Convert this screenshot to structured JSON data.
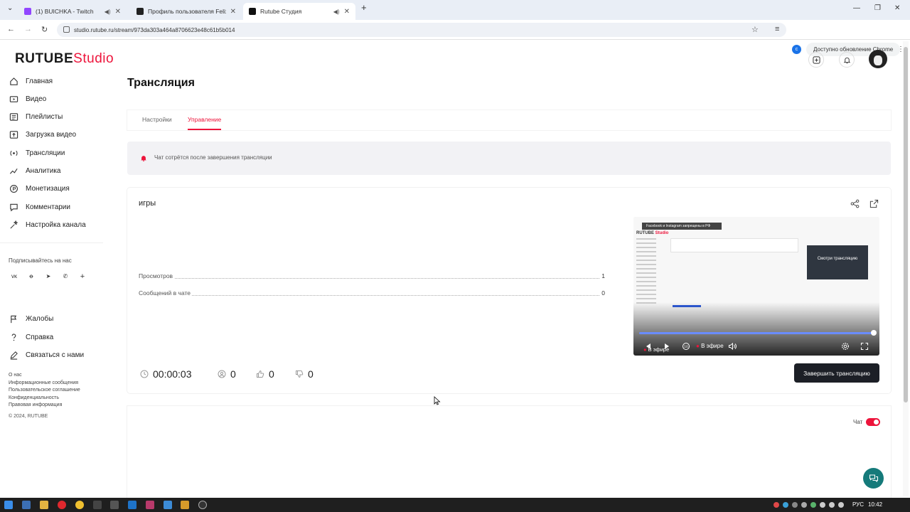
{
  "browser": {
    "tabs": [
      {
        "title": "(1) BUICHKA - Twitch",
        "favicon_color": "#9146ff"
      },
      {
        "title": "Профиль пользователя Felix",
        "favicon_color": "#222222"
      },
      {
        "title": "Rutube Студия",
        "favicon_color": "#111111"
      }
    ],
    "url": "studio.rutube.ru/stream/973da303a464a8706623e48c61b5b014",
    "profile_letter": "c",
    "update_label": "Доступно обновление Chrome"
  },
  "app": {
    "logo_main": "RUTUBE",
    "logo_studio": "Studio",
    "brand_color": "#ed143b"
  },
  "sidebar": {
    "items": [
      {
        "label": "Главная",
        "icon": "home-icon"
      },
      {
        "label": "Видео",
        "icon": "video-icon"
      },
      {
        "label": "Плейлисты",
        "icon": "playlist-icon"
      },
      {
        "label": "Загрузка видео",
        "icon": "upload-icon"
      },
      {
        "label": "Трансляции",
        "icon": "broadcast-icon"
      },
      {
        "label": "Аналитика",
        "icon": "analytics-icon"
      },
      {
        "label": "Монетизация",
        "icon": "monetization-icon"
      },
      {
        "label": "Комментарии",
        "icon": "comments-icon"
      },
      {
        "label": "Настройка канала",
        "icon": "channel-settings-icon"
      }
    ],
    "subscribe_label": "Подписывайтесь на нас",
    "socials": [
      "vk",
      "ok",
      "telegram",
      "viber",
      "more"
    ],
    "secondary": [
      {
        "label": "Жалобы",
        "icon": "flag-icon"
      },
      {
        "label": "Справка",
        "icon": "help-icon"
      },
      {
        "label": "Связаться с нами",
        "icon": "pencil-icon"
      }
    ],
    "footer_links": [
      "О нас",
      "Информационные сообщения",
      "Пользовательское соглашение",
      "Конфиденциальность",
      "Правовая информация"
    ],
    "copyright": "© 2024, RUTUBE"
  },
  "page": {
    "title": "Трансляция",
    "tabs": [
      "Настройки",
      "Управление"
    ],
    "active_tab": "Управление",
    "notice": "Чат сотрётся после завершения трансляции"
  },
  "stream": {
    "name": "игры",
    "stats": [
      {
        "label": "Просмотров",
        "value": "1"
      },
      {
        "label": "Сообщений в чате",
        "value": "0"
      }
    ],
    "duration": "00:00:03",
    "viewers": "0",
    "likes": "0",
    "dislikes": "0",
    "end_button": "Завершить трансляцию",
    "player": {
      "banner": "Facebook и Instagram запрещены в РФ",
      "watch_label": "Смотри трансляцию",
      "live_label": "В эфире",
      "live_label_small": "В эфире",
      "progress": 1.0
    }
  },
  "chat": {
    "label": "Чат",
    "enabled": true
  },
  "taskbar": {
    "language": "РУС",
    "time": "10:42"
  }
}
